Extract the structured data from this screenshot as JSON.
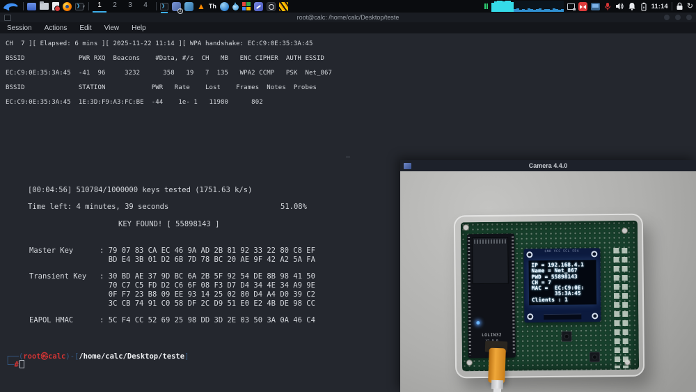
{
  "colors": {
    "accent_blue": "#3daee9",
    "graph_cyan": "#35dbe8",
    "prompt_blue": "#355a86",
    "prompt_red": "#d23434",
    "terminal_bg": "#24272e",
    "panel_bg": "#0a0c0f"
  },
  "taskbar": {
    "workspaces": [
      "1",
      "2",
      "3",
      "4"
    ],
    "active_workspace": "1",
    "badge": "2",
    "clock": "11:14",
    "icons": {
      "vlc": "▲",
      "texstudio": "Th",
      "dropdown": "▾",
      "power": "↻",
      "battery_bolt": "ϟ"
    },
    "cpu_graph_bars": [
      13,
      15,
      16,
      16,
      15,
      16,
      16,
      14,
      4,
      5,
      3,
      4,
      3,
      5,
      4,
      3,
      4,
      5,
      3,
      4,
      4,
      3,
      5,
      4,
      3,
      4
    ]
  },
  "terminal": {
    "title": "root@calc: /home/calc/Desktop/teste",
    "menu": [
      "Session",
      "Actions",
      "Edit",
      "View",
      "Help"
    ],
    "airodump": {
      "status_line": "CH  7 ][ Elapsed: 6 mins ][ 2025-11-22 11:14 ][ WPA handshake: EC:C9:0E:35:3A:45",
      "ap_header": "BSSID              PWR RXQ  Beacons    #Data, #/s  CH   MB   ENC CIPHER  AUTH ESSID",
      "ap_row": "EC:C9:0E:35:3A:45  -41  96     3232      358   19   7  135   WPA2 CCMP   PSK  Net_867",
      "station_header": "BSSID              STATION            PWR   Rate    Lost    Frames  Notes  Probes",
      "station_row": "EC:C9:0E:35:3A:45  1E:3D:F9:A3:FC:BE  -44    1e- 1   11980      802"
    },
    "dash": "—",
    "aircrack": {
      "progress": "[00:04:56] 510784/1000000 keys tested (1751.63 k/s)",
      "time_left": "Time left: 4 minutes, 39 seconds",
      "percent": "51.08%",
      "key_found": "KEY FOUND! [ 55898143 ]",
      "master_key": [
        "Master Key      : 79 07 83 CA EC 46 9A AD 2B 81 92 33 22 80 C8 EF",
        "                  BD E4 3B 01 D2 6B 7D 78 BC 20 AE 9F 42 A2 5A FA"
      ],
      "transient_key": [
        "Transient Key   : 30 BD AE 37 9D BC 6A 2B 5F 92 54 DE 8B 98 41 50",
        "                  70 C7 C5 FD D2 C6 6F 08 F3 D7 D4 34 4E 34 A9 9E",
        "                  0F F7 23 B8 09 EE 93 14 25 02 80 D4 A4 D0 39 C2",
        "                  3C CB 74 91 C0 58 DF 2C D9 51 E0 E2 4B DE 98 CC"
      ],
      "eapol_hmac": "EAPOL HMAC      : 5C F4 CC 52 69 25 98 DD 3D 2E 03 50 3A 0A 46 C4"
    },
    "prompt": {
      "open": "┌──(",
      "user": "root㉿calc",
      "mid": ")-[",
      "path": "/home/calc/Desktop/teste",
      "close": "]",
      "line2": "└─",
      "hash": "#"
    }
  },
  "camera": {
    "title": "Camera 4.4.0",
    "board": {
      "devboard_label": "LOLIN32",
      "devboard_version": "V1.0.0",
      "oled_pin_header": "GND VCC SCL SDA",
      "oled_lines": [
        "IP = 192.168.4.1",
        "Name = Net_867",
        "PWD = 55898143",
        "CH = 7",
        "MAC =  EC:C9:0E:",
        "       35:3A:45",
        "Clients : 1"
      ]
    }
  }
}
